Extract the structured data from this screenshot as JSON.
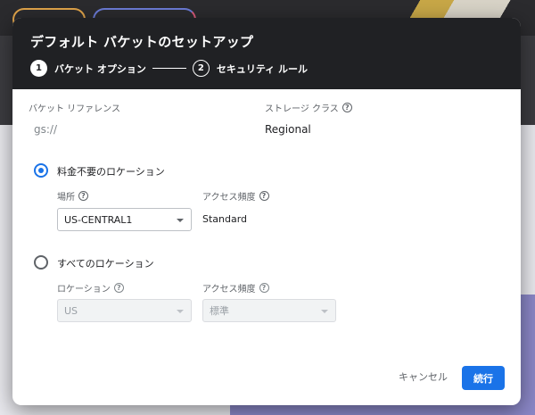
{
  "dialog": {
    "title": "デフォルト バケットのセットアップ",
    "steps": [
      {
        "number": "1",
        "label": "バケット オプション"
      },
      {
        "number": "2",
        "label": "セキュリティ ルール"
      }
    ]
  },
  "bucket_reference": {
    "label": "バケット リファレンス",
    "value": "gs://"
  },
  "storage_class": {
    "label": "ストレージ クラス",
    "value": "Regional"
  },
  "free_location": {
    "radio_label": "料金不要のロケーション",
    "location_label": "場所",
    "location_value": "US-CENTRAL1",
    "access_label": "アクセス頻度",
    "access_value": "Standard"
  },
  "all_locations": {
    "radio_label": "すべてのロケーション",
    "location_label": "ロケーション",
    "location_value": "US",
    "access_label": "アクセス頻度",
    "access_value": "標準"
  },
  "actions": {
    "cancel": "キャンセル",
    "continue": "続行"
  },
  "icons": {
    "help": "help-icon",
    "dropdown": "chevron-down-icon"
  },
  "colors": {
    "accent": "#1a73e8",
    "header": "#202124"
  }
}
